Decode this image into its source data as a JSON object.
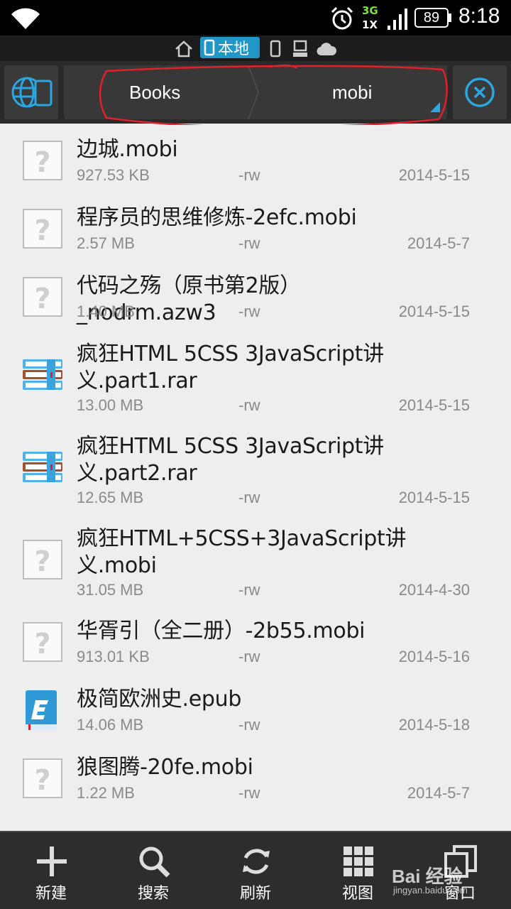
{
  "status_bar": {
    "network_top": "3G",
    "network_bottom": "1X",
    "battery": "89",
    "time": "8:18"
  },
  "location_tabs": {
    "local_label": "本地"
  },
  "path": {
    "crumbs": [
      "Books",
      "mobi"
    ]
  },
  "files": [
    {
      "name": "边城.mobi",
      "size": "927.53 KB",
      "perm": "-rw",
      "date": "2014-5-15",
      "icon": "unknown-file-icon"
    },
    {
      "name": "程序员的思维修炼-2efc.mobi",
      "size": "2.57 MB",
      "perm": "-rw",
      "date": "2014-5-7",
      "icon": "unknown-file-icon"
    },
    {
      "name": "代码之殇（原书第2版）_nodrm.azw3",
      "size": "1.40 MB",
      "perm": "-rw",
      "date": "2014-5-15",
      "icon": "unknown-file-icon"
    },
    {
      "name": "疯狂HTML 5CSS 3JavaScript讲义.part1.rar",
      "size": "13.00 MB",
      "perm": "-rw",
      "date": "2014-5-15",
      "icon": "archive-icon"
    },
    {
      "name": "疯狂HTML 5CSS 3JavaScript讲义.part2.rar",
      "size": "12.65 MB",
      "perm": "-rw",
      "date": "2014-5-15",
      "icon": "archive-icon"
    },
    {
      "name": "疯狂HTML+5CSS+3JavaScript讲义.mobi",
      "size": "31.05 MB",
      "perm": "-rw",
      "date": "2014-4-30",
      "icon": "unknown-file-icon"
    },
    {
      "name": "华胥引（全二册）-2b55.mobi",
      "size": "913.01 KB",
      "perm": "-rw",
      "date": "2014-5-16",
      "icon": "unknown-file-icon"
    },
    {
      "name": "极简欧洲史.epub",
      "size": "14.06 MB",
      "perm": "-rw",
      "date": "2014-5-18",
      "icon": "epub-icon"
    },
    {
      "name": "狼图腾-20fe.mobi",
      "size": "1.22 MB",
      "perm": "-rw",
      "date": "2014-5-7",
      "icon": "unknown-file-icon"
    }
  ],
  "toolbar": {
    "new_label": "新建",
    "search_label": "搜索",
    "refresh_label": "刷新",
    "view_label": "视图",
    "window_label": "窗口"
  },
  "watermark": {
    "brand": "Bai 经验",
    "url": "jingyan.baidu.com"
  },
  "colors": {
    "accent": "#2196c8",
    "annotation": "#e0202a"
  }
}
